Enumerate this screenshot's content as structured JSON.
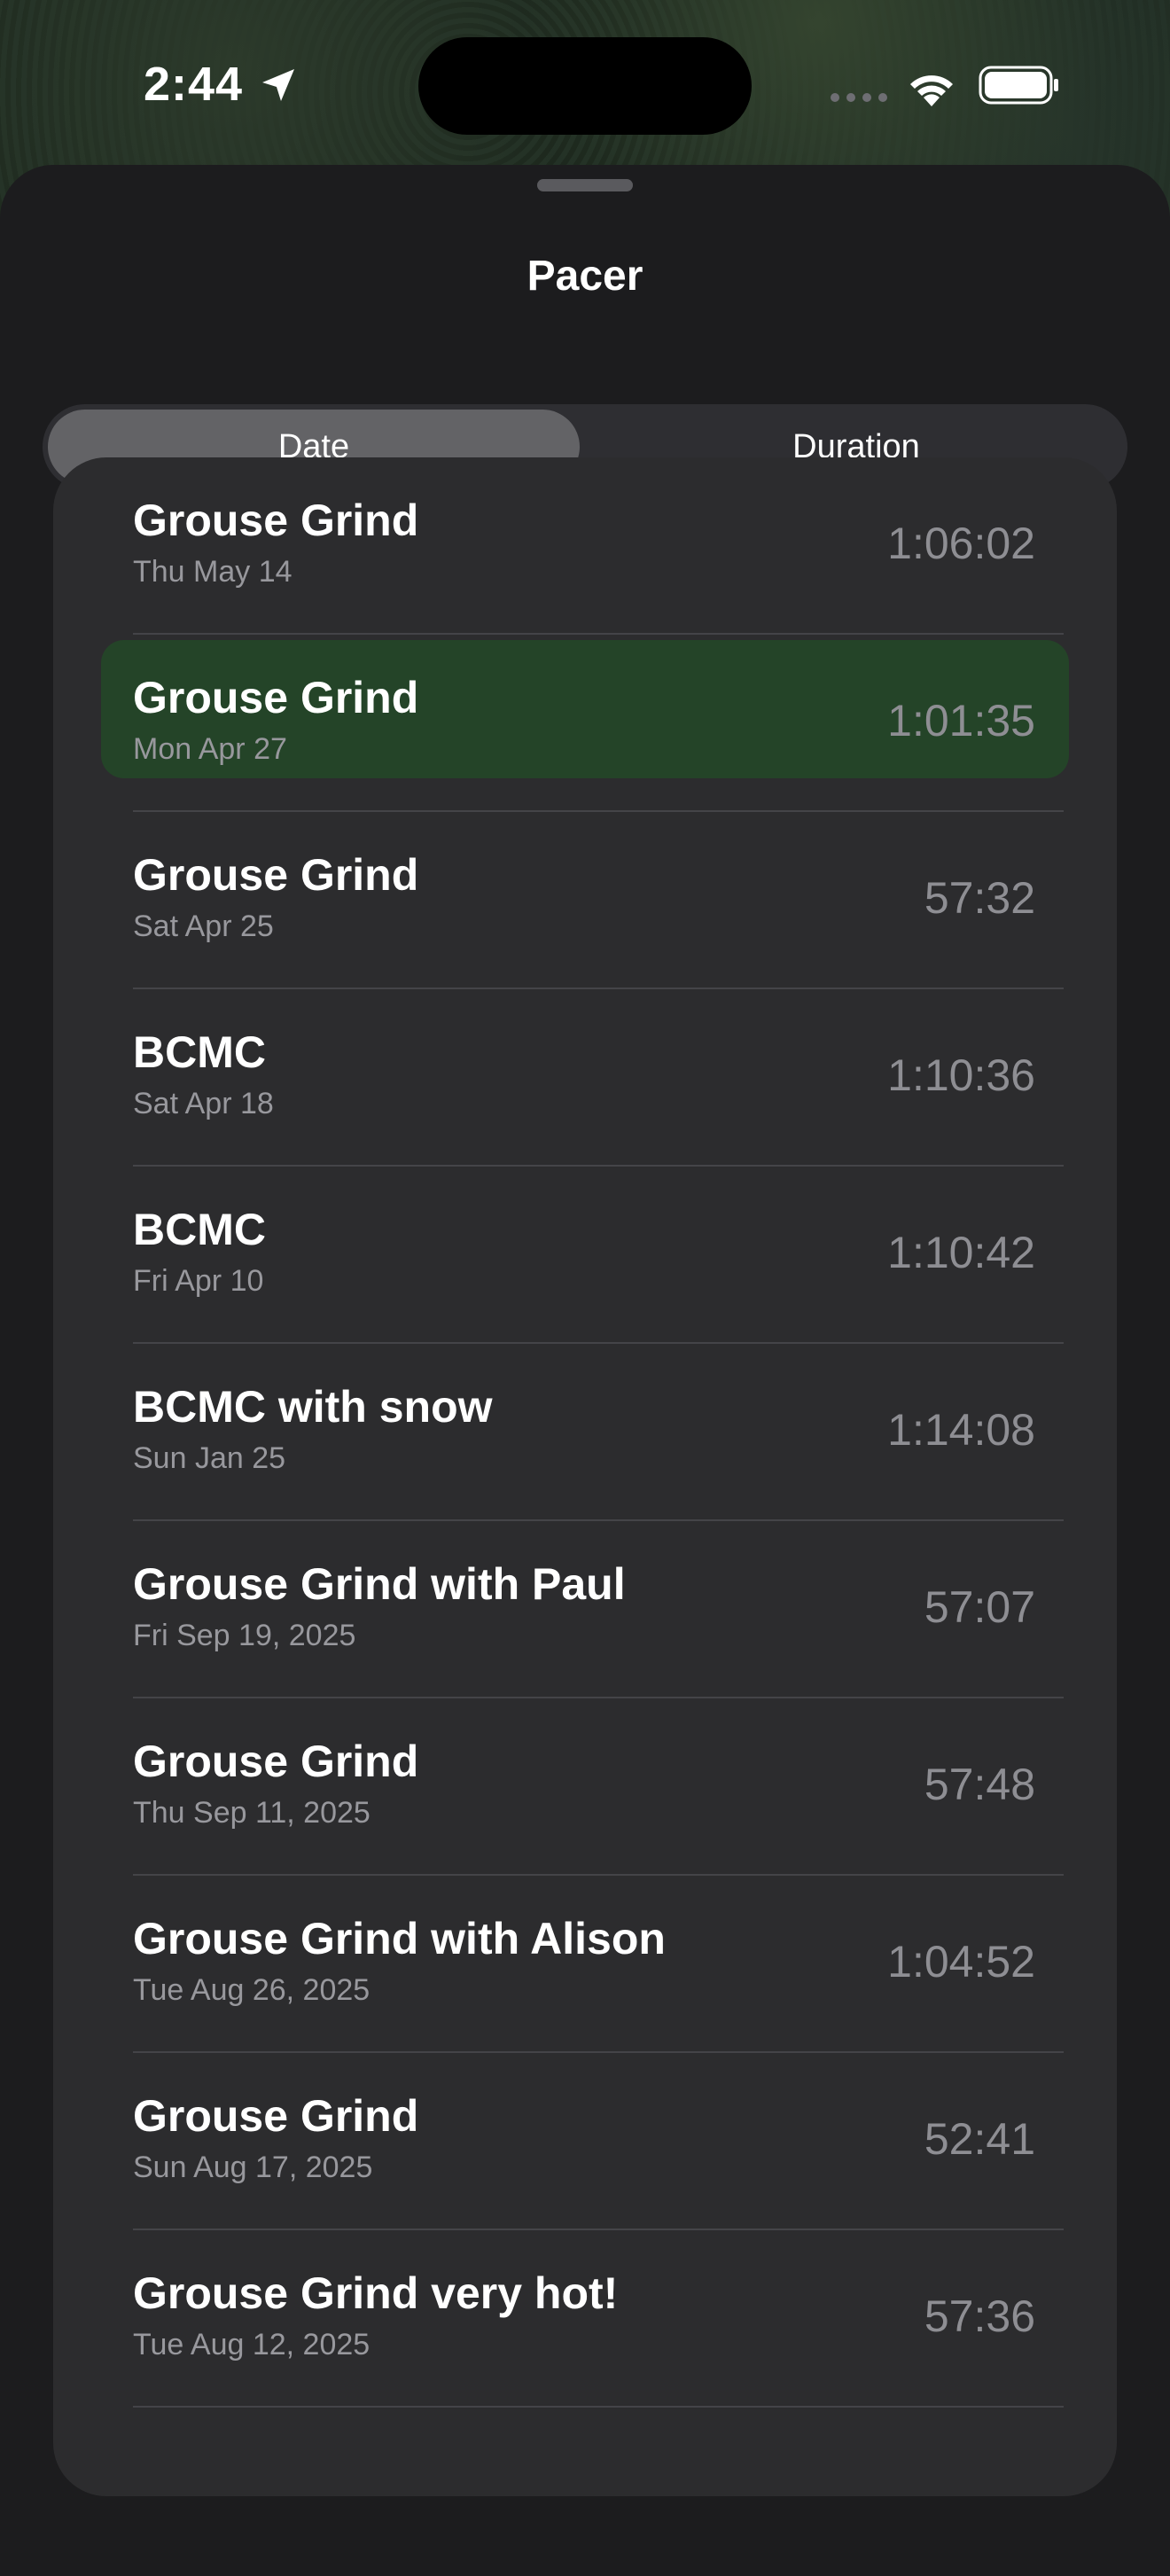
{
  "status_bar": {
    "time": "2:44"
  },
  "sheet": {
    "title": "Pacer"
  },
  "sort_control": {
    "options": [
      "Date",
      "Duration"
    ],
    "selected": "Date"
  },
  "colors": {
    "highlight": "#244428",
    "card": "#2c2c2e",
    "sheet": "#1c1c1e"
  },
  "workouts": [
    {
      "name": "Grouse Grind",
      "date": "Thu May 14",
      "duration": "1:06:02"
    },
    {
      "name": "Grouse Grind",
      "date": "Mon Apr 27",
      "duration": "1:01:35",
      "highlighted": true
    },
    {
      "name": "Grouse Grind",
      "date": "Sat Apr 25",
      "duration": "57:32"
    },
    {
      "name": "BCMC",
      "date": "Sat Apr 18",
      "duration": "1:10:36"
    },
    {
      "name": "BCMC",
      "date": "Fri Apr 10",
      "duration": "1:10:42"
    },
    {
      "name": "BCMC with snow",
      "date": "Sun Jan 25",
      "duration": "1:14:08"
    },
    {
      "name": "Grouse Grind with Paul",
      "date": "Fri Sep 19, 2025",
      "duration": "57:07"
    },
    {
      "name": "Grouse Grind",
      "date": "Thu Sep 11, 2025",
      "duration": "57:48"
    },
    {
      "name": "Grouse Grind with Alison",
      "date": "Tue Aug 26, 2025",
      "duration": "1:04:52"
    },
    {
      "name": "Grouse Grind",
      "date": "Sun Aug 17, 2025",
      "duration": "52:41"
    },
    {
      "name": "Grouse Grind very hot!",
      "date": "Tue Aug 12, 2025",
      "duration": "57:36"
    }
  ]
}
